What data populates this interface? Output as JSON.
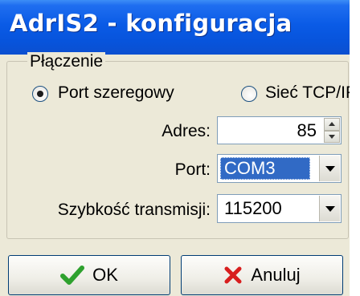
{
  "window": {
    "title": "AdrIS2 - konfiguracja",
    "accent_color": "#0a5be6"
  },
  "group": {
    "label": "Płączenie"
  },
  "connection": {
    "options": [
      {
        "label": "Port szeregowy",
        "selected": true
      },
      {
        "label": "Sieć TCP/IP",
        "selected": false
      }
    ]
  },
  "fields": {
    "address": {
      "label": "Adres:",
      "value": "85"
    },
    "port": {
      "label": "Port:",
      "value": "COM3"
    },
    "baud": {
      "label": "Szybkość transmisji:",
      "value": "115200"
    }
  },
  "buttons": {
    "ok": {
      "label": "OK",
      "icon": "checkmark-icon",
      "icon_color": "#2ea12e"
    },
    "cancel": {
      "label": "Anuluj",
      "icon": "x-icon",
      "icon_color": "#d81e1e"
    }
  }
}
